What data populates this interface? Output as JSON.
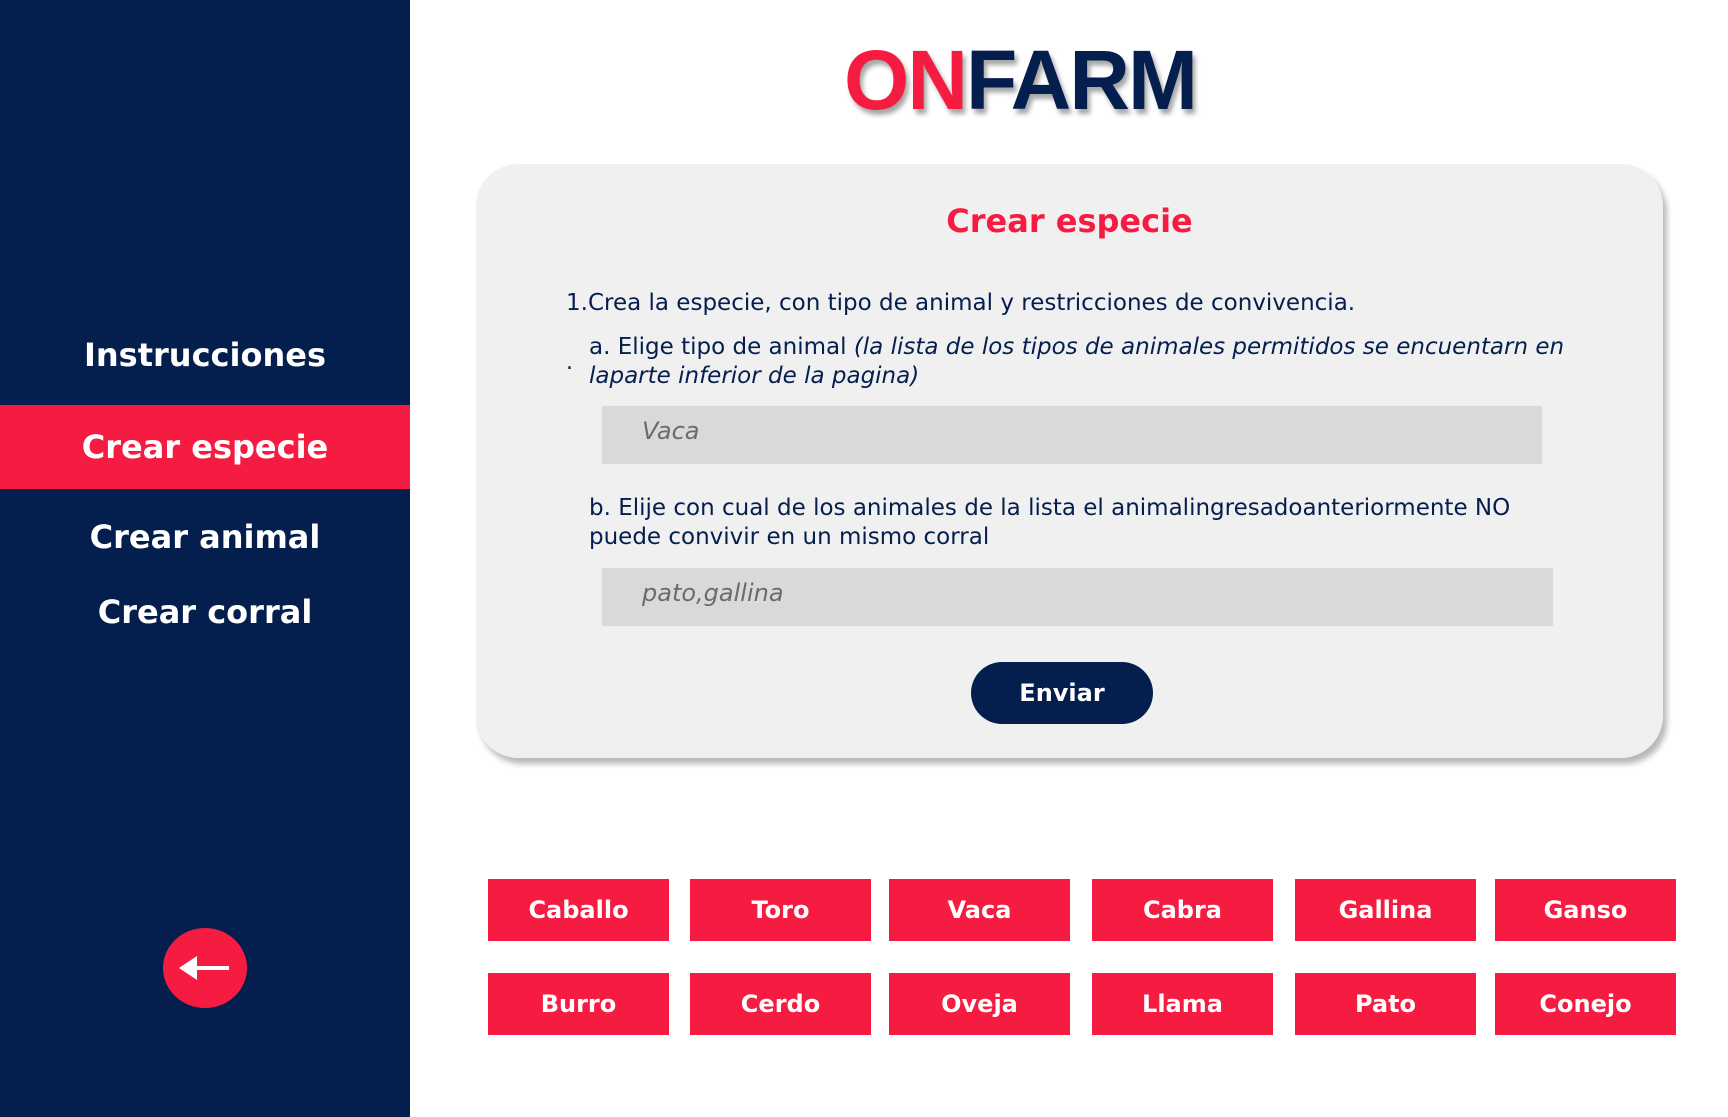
{
  "brand": {
    "logo_on": "ON",
    "logo_farm": "FARM",
    "accent_color": "#f61c41",
    "navy_color": "#041e4d"
  },
  "sidebar": {
    "items": [
      {
        "label": "Instrucciones",
        "active": false
      },
      {
        "label": "Crear especie",
        "active": true
      },
      {
        "label": "Crear animal",
        "active": false
      },
      {
        "label": "Crear corral",
        "active": false
      }
    ],
    "back_icon": "arrow-left-icon"
  },
  "form": {
    "title": "Crear especie",
    "step1": "1.Crea la especie, con tipo de animal y restricciones de convivencia.",
    "step_a_label": "a. Elige tipo de  animal ",
    "step_a_hint": "(la lista de los tipos de animales permitidos se encuentarn en laparte inferior de la pagina)",
    "bullet": ".",
    "animal_type_value": "Vaca",
    "step_b_label": "b. Elije con cual de los animales de la lista el animalingresadoanteriormente NO puede convivir en un mismo corral",
    "restrictions_value": "pato,gallina",
    "submit_label": "Enviar"
  },
  "animals": {
    "row1": [
      "Caballo",
      "Toro",
      "Vaca",
      "Cabra",
      "Gallina",
      "Ganso"
    ],
    "row2": [
      "Burro",
      "Cerdo",
      "Oveja",
      "Llama",
      "Pato",
      "Conejo"
    ]
  }
}
